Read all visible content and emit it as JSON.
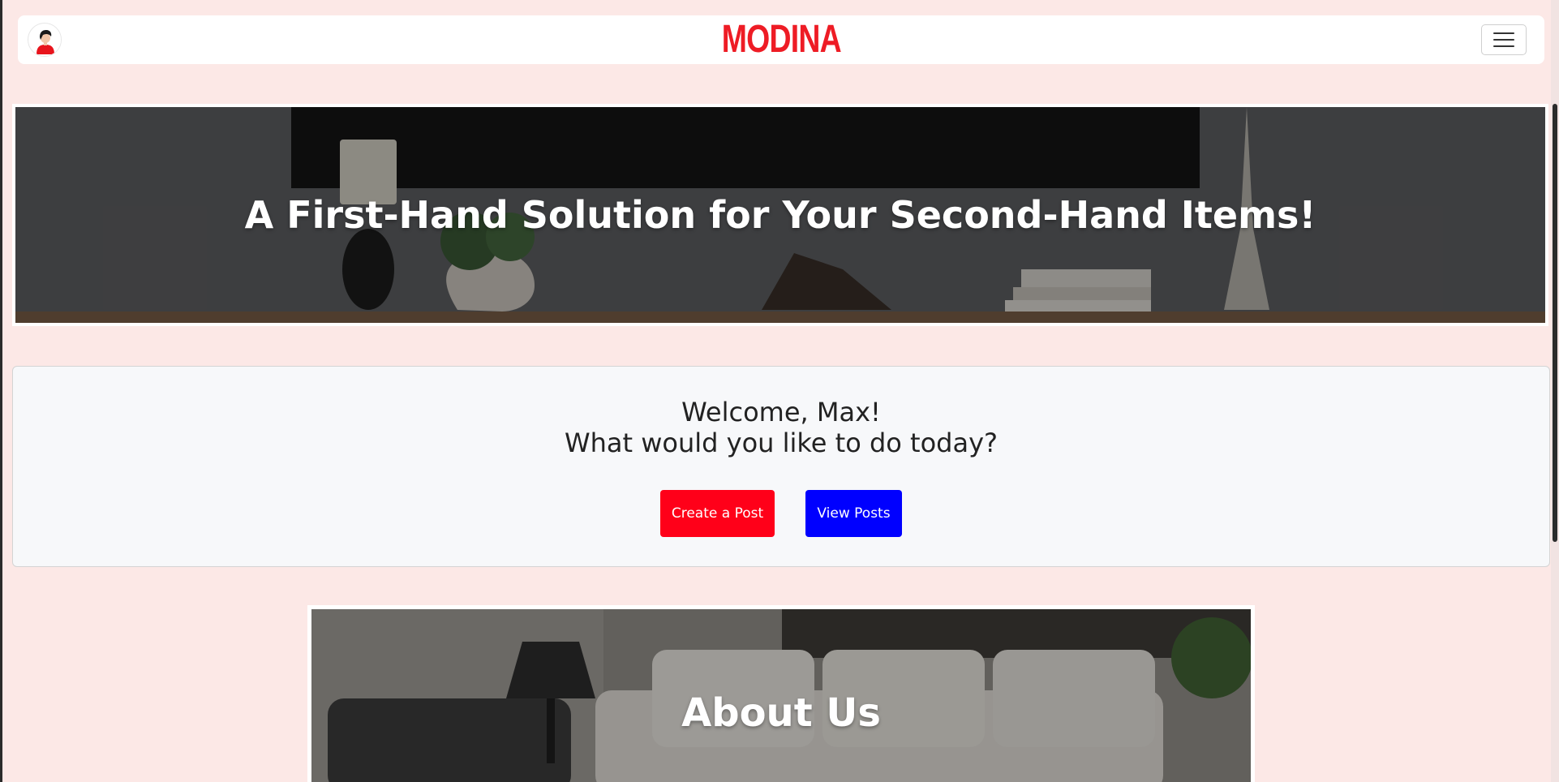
{
  "navbar": {
    "brand": "MODINA",
    "avatar_icon": "user-avatar-icon",
    "menu_icon": "hamburger-menu-icon"
  },
  "hero": {
    "title": "A First-Hand Solution for Your Second-Hand Items!"
  },
  "welcome": {
    "greeting": "Welcome, Max!",
    "prompt": "What would you like to do today?",
    "create_label": "Create a Post",
    "view_label": "View Posts"
  },
  "about": {
    "title": "About Us"
  },
  "colors": {
    "page_background": "#fce8e6",
    "brand_red": "#ee1c25",
    "create_button": "#ff0019",
    "view_button": "#0000ff"
  }
}
